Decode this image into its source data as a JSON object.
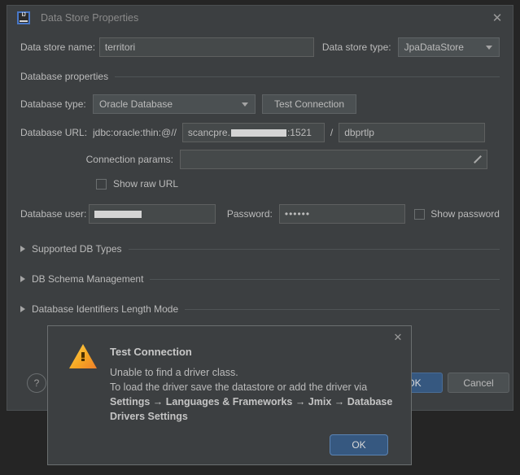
{
  "window": {
    "title": "Data Store Properties",
    "app_icon": "intellij-idea-icon",
    "close_icon": "✕"
  },
  "form": {
    "data_store_name_label": "Data store name:",
    "data_store_name_value": "territori",
    "data_store_type_label": "Data store type:",
    "data_store_type_value": "JpaDataStore",
    "database_properties_group": "Database properties",
    "database_type_label": "Database type:",
    "database_type_value": "Oracle Database",
    "test_connection_button": "Test Connection",
    "database_url_label": "Database URL:",
    "url_prefix": "jdbc:oracle:thin:@//",
    "url_host_value": "scancpre.",
    "url_port_value": ":1521",
    "url_separator": "/",
    "url_sid_value": "dbprtlp",
    "connection_params_label": "Connection params:",
    "connection_params_value": "",
    "connection_params_edit_icon": "pencil-icon",
    "show_raw_url_label": "Show raw URL",
    "show_raw_url_checked": false,
    "database_user_label": "Database user:",
    "database_user_value": "",
    "password_label": "Password:",
    "password_value": "••••••",
    "show_password_label": "Show password",
    "show_password_checked": false
  },
  "sections": [
    {
      "label": "Supported DB Types",
      "expanded": false
    },
    {
      "label": "DB Schema Management",
      "expanded": false
    },
    {
      "label": "Database Identifiers Length Mode",
      "expanded": false
    }
  ],
  "footer": {
    "help_label": "?",
    "ok_label": "OK",
    "cancel_label": "Cancel"
  },
  "modal": {
    "title": "Test Connection",
    "close_icon": "✕",
    "icon": "warning-triangle-icon",
    "line1": "Unable to find a driver class.",
    "line2": "To load the driver save the datastore or add the driver via",
    "line3": "Settings → Languages & Frameworks → Jmix → Database",
    "line4": "Drivers Settings",
    "ok_label": "OK"
  },
  "colors": {
    "dialog_bg": "#3c3f41",
    "outer_bg": "#252525",
    "accent_blue": "#365880",
    "field_bg": "#45494a",
    "text": "#bbbbbb",
    "warning_orange": "#f5a623"
  }
}
